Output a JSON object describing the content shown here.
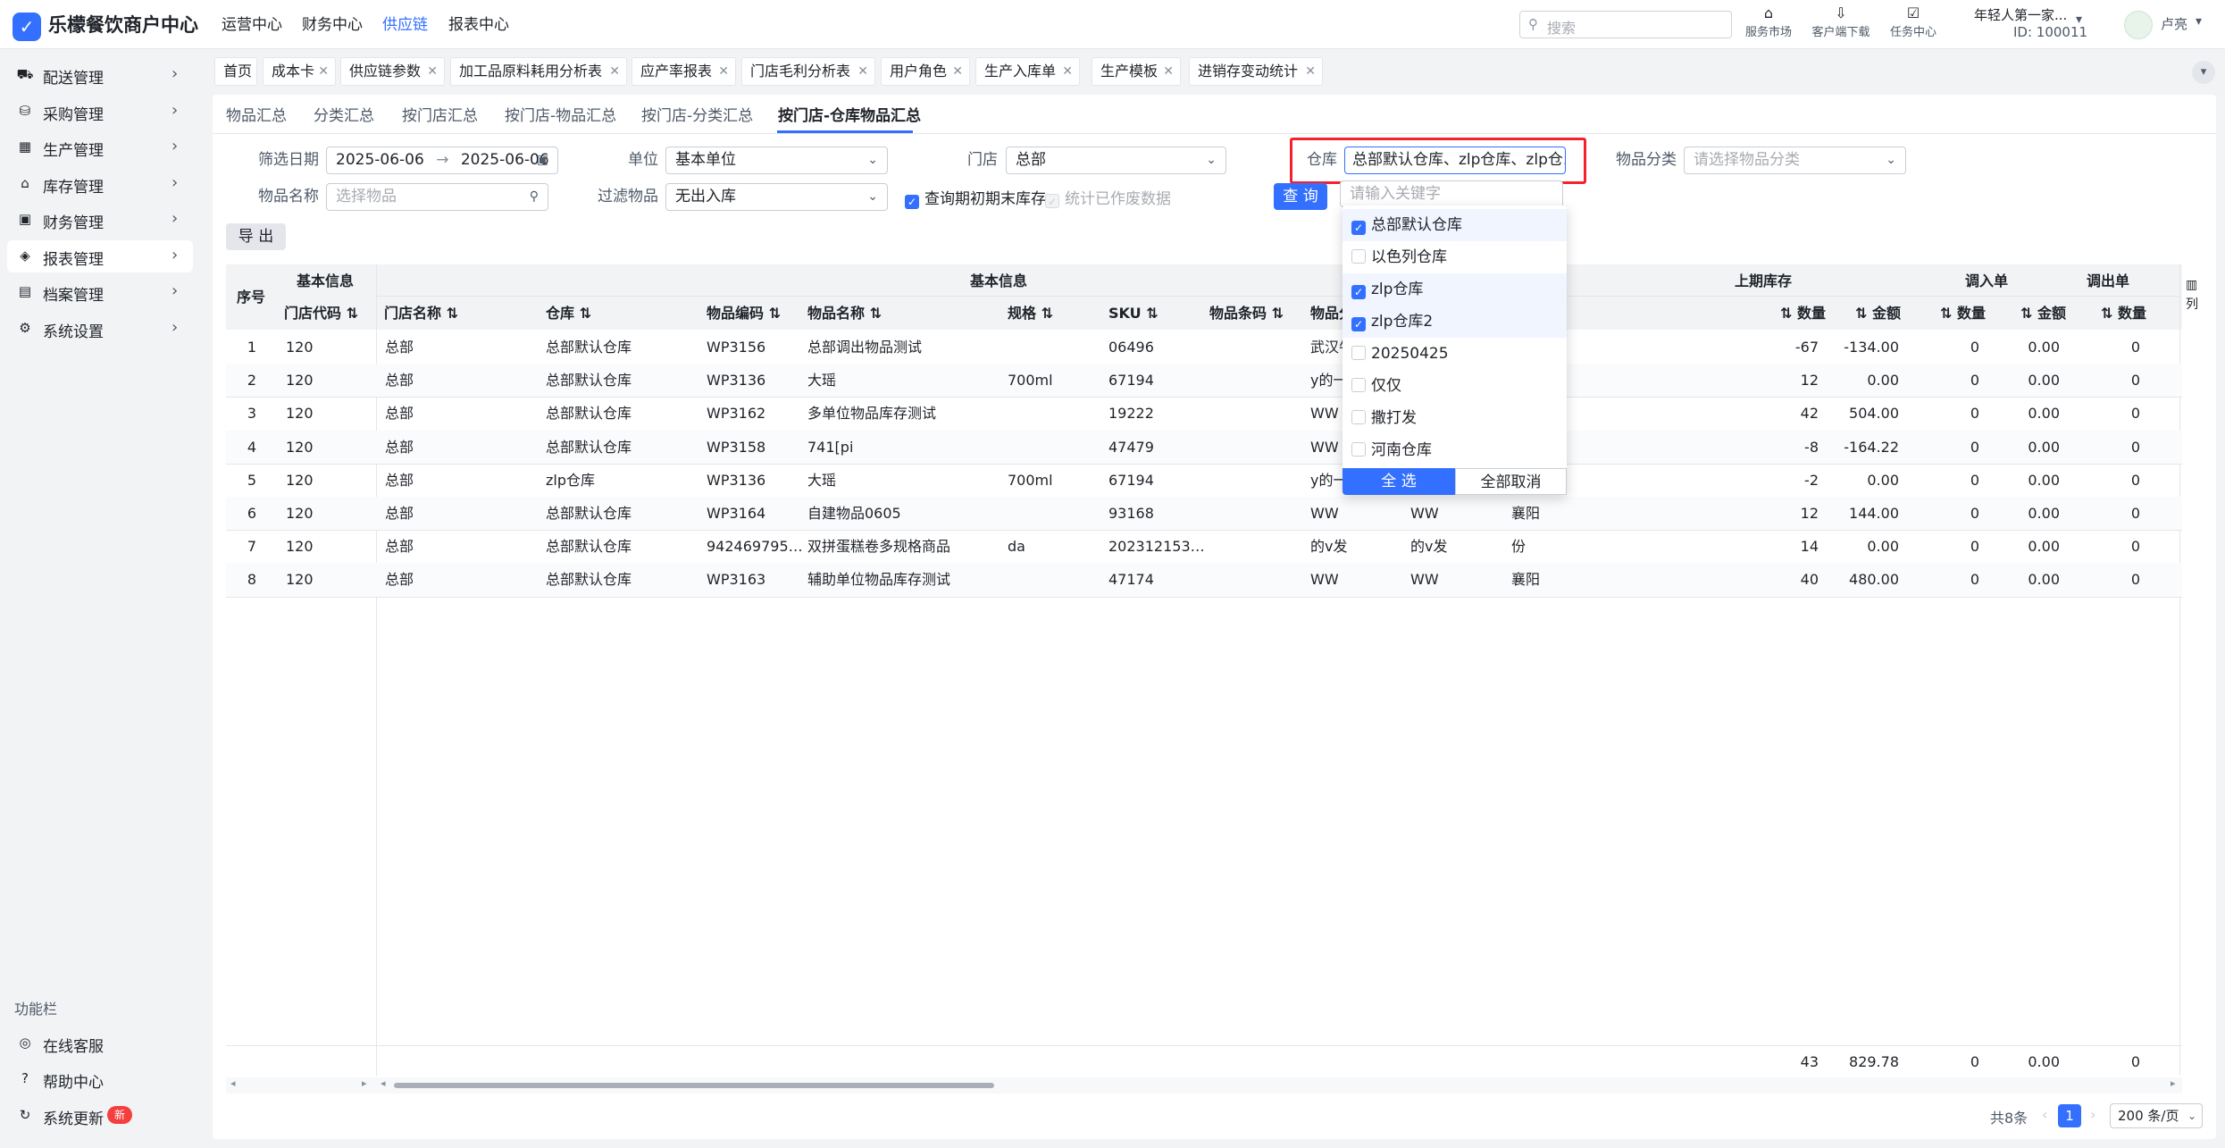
{
  "app": {
    "logo_glyph": "✓",
    "title": "乐檬餐饮商户中心"
  },
  "topnav": [
    "运营中心",
    "财务中心",
    "供应链",
    "报表中心"
  ],
  "topnav_active": 2,
  "search": {
    "placeholder": "搜索"
  },
  "top_icons": [
    {
      "icon": "store-icon",
      "glyph": "⌂",
      "label": "服务市场"
    },
    {
      "icon": "download-icon",
      "glyph": "⇩",
      "label": "客户端下载"
    },
    {
      "icon": "task-icon",
      "glyph": "☑",
      "label": "任务中心"
    }
  ],
  "user": {
    "org": "年轻人第一家...",
    "id": "ID: 100011",
    "name": "卢亮"
  },
  "sidebar": {
    "items": [
      {
        "icon": "truck-icon",
        "glyph": "⛟",
        "label": "配送管理"
      },
      {
        "icon": "cart-icon",
        "glyph": "⛁",
        "label": "采购管理"
      },
      {
        "icon": "factory-icon",
        "glyph": "▦",
        "label": "生产管理"
      },
      {
        "icon": "warehouse-icon",
        "glyph": "⌂",
        "label": "库存管理"
      },
      {
        "icon": "wallet-icon",
        "glyph": "▣",
        "label": "财务管理"
      },
      {
        "icon": "report-icon",
        "glyph": "◈",
        "label": "报表管理"
      },
      {
        "icon": "archive-icon",
        "glyph": "▤",
        "label": "档案管理"
      },
      {
        "icon": "settings-icon",
        "glyph": "⚙",
        "label": "系统设置"
      }
    ],
    "active": 5,
    "func_label": "功能栏",
    "func_items": [
      {
        "icon": "service-icon",
        "glyph": "◎",
        "label": "在线客服"
      },
      {
        "icon": "help-icon",
        "glyph": "?",
        "label": "帮助中心"
      },
      {
        "icon": "update-icon",
        "glyph": "↻",
        "label": "系统更新",
        "badge": "新"
      }
    ]
  },
  "tabs": [
    "首页",
    "成本卡",
    "供应链参数",
    "加工品原料耗用分析表",
    "应产率报表",
    "门店毛利分析表",
    "用户角色",
    "生产入库单",
    "生产模板",
    "进销存变动统计"
  ],
  "sub_tabs": [
    "物品汇总",
    "分类汇总",
    "按门店汇总",
    "按门店-物品汇总",
    "按门店-分类汇总",
    "按门店-仓库物品汇总"
  ],
  "sub_tab_active": 5,
  "filters": {
    "date_label": "筛选日期",
    "date_start": "2025-06-06",
    "date_end": "2025-06-06",
    "unit_label": "单位",
    "unit_value": "基本单位",
    "store_label": "门店",
    "store_value": "总部",
    "warehouse_label": "仓库",
    "warehouse_value": "总部默认仓库、zlp仓库、zlp仓...",
    "category_label": "物品分类",
    "category_placeholder": "请选择物品分类",
    "item_label": "物品名称",
    "item_placeholder": "选择物品",
    "filter_label": "过滤物品",
    "filter_value": "无出入库",
    "check_initial": "查询期初期末库存",
    "check_voided": "统计已作废数据",
    "query_btn": "查 询",
    "export_btn": "导 出"
  },
  "warehouse_dropdown": {
    "search_placeholder": "请输入关键字",
    "options": [
      {
        "label": "总部默认仓库",
        "checked": true
      },
      {
        "label": "以色列仓库",
        "checked": false
      },
      {
        "label": "zlp仓库",
        "checked": true
      },
      {
        "label": "zlp仓库2",
        "checked": true
      },
      {
        "label": "20250425",
        "checked": false
      },
      {
        "label": "仅仅",
        "checked": false
      },
      {
        "label": "撒打发",
        "checked": false
      },
      {
        "label": "河南仓库",
        "checked": false
      }
    ],
    "select_all": "全 选",
    "cancel_all": "全部取消"
  },
  "table": {
    "group1": "基本信息",
    "group2": "基本信息",
    "group3": "上期库存",
    "group4": "调入单",
    "group5": "调出单",
    "seq_header": "序号",
    "columns": [
      "门店代码",
      "门店名称",
      "仓库",
      "物品编码",
      "物品名称",
      "规格",
      "SKU",
      "物品条码",
      "物品分"
    ],
    "num_headers": [
      "数量",
      "金额",
      "数量",
      "金额",
      "数量"
    ],
    "col_toggle": "列",
    "rows": [
      {
        "seq": "1",
        "code": "120",
        "store": "总部",
        "wh": "总部默认仓库",
        "item_code": "WP3156",
        "item_name": "总部调出物品测试",
        "spec": "",
        "sku": "06496",
        "c1": "武汉牛",
        "c2": "",
        "c3": "",
        "qty": "-67",
        "amt": "-134.00",
        "in_qty": "0",
        "in_amt": "0.00",
        "out_qty": "0"
      },
      {
        "seq": "2",
        "code": "120",
        "store": "总部",
        "wh": "总部默认仓库",
        "item_code": "WP3136",
        "item_name": "大瑶",
        "spec": "700ml",
        "sku": "67194",
        "c1": "y的一",
        "c2": "",
        "c3": "",
        "qty": "12",
        "amt": "0.00",
        "in_qty": "0",
        "in_amt": "0.00",
        "out_qty": "0"
      },
      {
        "seq": "3",
        "code": "120",
        "store": "总部",
        "wh": "总部默认仓库",
        "item_code": "WP3162",
        "item_name": "多单位物品库存测试",
        "spec": "",
        "sku": "19222",
        "c1": "WW",
        "c2": "",
        "c3": "",
        "qty": "42",
        "amt": "504.00",
        "in_qty": "0",
        "in_amt": "0.00",
        "out_qty": "0"
      },
      {
        "seq": "4",
        "code": "120",
        "store": "总部",
        "wh": "总部默认仓库",
        "item_code": "WP3158",
        "item_name": "741[pi",
        "spec": "",
        "sku": "47479",
        "c1": "WW",
        "c2": "",
        "c3": "",
        "qty": "-8",
        "amt": "-164.22",
        "in_qty": "0",
        "in_amt": "0.00",
        "out_qty": "0"
      },
      {
        "seq": "5",
        "code": "120",
        "store": "总部",
        "wh": "zlp仓库",
        "item_code": "WP3136",
        "item_name": "大瑶",
        "spec": "700ml",
        "sku": "67194",
        "c1": "y的一",
        "c2": "",
        "c3": "",
        "qty": "-2",
        "amt": "0.00",
        "in_qty": "0",
        "in_amt": "0.00",
        "out_qty": "0"
      },
      {
        "seq": "6",
        "code": "120",
        "store": "总部",
        "wh": "总部默认仓库",
        "item_code": "WP3164",
        "item_name": "自建物品0605",
        "spec": "",
        "sku": "93168",
        "c1": "WW",
        "c2": "WW",
        "c3": "襄阳",
        "qty": "12",
        "amt": "144.00",
        "in_qty": "0",
        "in_amt": "0.00",
        "out_qty": "0"
      },
      {
        "seq": "7",
        "code": "120",
        "store": "总部",
        "wh": "总部默认仓库",
        "item_code": "942469795…",
        "item_name": "双拼蛋糕卷多规格商品",
        "spec": "da",
        "sku": "202312153…",
        "c1": "的v发",
        "c2": "的v发",
        "c3": "份",
        "qty": "14",
        "amt": "0.00",
        "in_qty": "0",
        "in_amt": "0.00",
        "out_qty": "0"
      },
      {
        "seq": "8",
        "code": "120",
        "store": "总部",
        "wh": "总部默认仓库",
        "item_code": "WP3163",
        "item_name": "辅助单位物品库存测试",
        "spec": "",
        "sku": "47174",
        "c1": "WW",
        "c2": "WW",
        "c3": "襄阳",
        "qty": "40",
        "amt": "480.00",
        "in_qty": "0",
        "in_amt": "0.00",
        "out_qty": "0"
      }
    ],
    "totals": {
      "qty": "43",
      "amt": "829.78",
      "in_qty": "0",
      "in_amt": "0.00",
      "out_qty": "0"
    }
  },
  "pagination": {
    "total": "共8条",
    "page": "1",
    "page_size": "200 条/页"
  }
}
